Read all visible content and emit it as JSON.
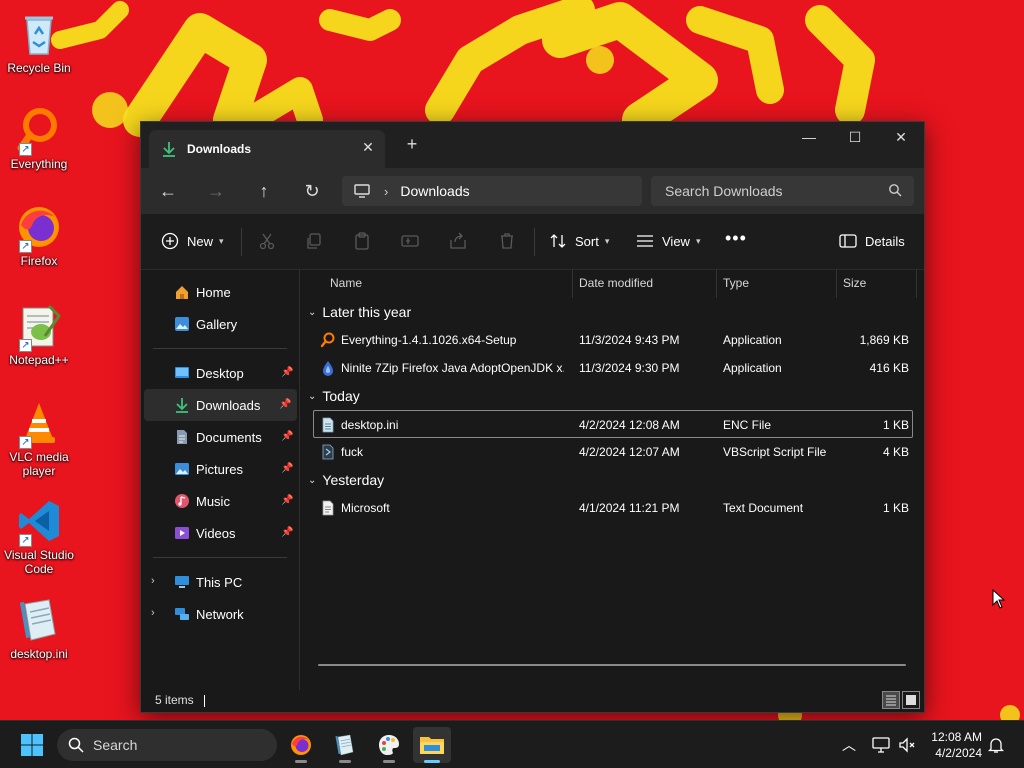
{
  "desktop": {
    "icons": [
      {
        "label": "Recycle Bin",
        "icon": "recycle-bin-icon"
      },
      {
        "label": "Everything",
        "icon": "everything-icon"
      },
      {
        "label": "Firefox",
        "icon": "firefox-icon"
      },
      {
        "label": "Notepad++",
        "icon": "notepad-plus-plus-icon"
      },
      {
        "label": "VLC media player",
        "icon": "vlc-icon"
      },
      {
        "label": "Visual Studio Code",
        "icon": "vscode-icon"
      },
      {
        "label": "desktop.ini",
        "icon": "ini-file-icon"
      }
    ],
    "wallpaper_colors": {
      "background": "#e8141e",
      "accent": "#f6e11d"
    }
  },
  "window": {
    "tab_title": "Downloads",
    "breadcrumb": "Downloads",
    "search_placeholder": "Search Downloads",
    "toolbar": {
      "new_label": "New",
      "sort_label": "Sort",
      "view_label": "View",
      "details_label": "Details"
    },
    "nav": {
      "top": [
        {
          "label": "Home",
          "icon": "home-icon"
        },
        {
          "label": "Gallery",
          "icon": "gallery-icon"
        }
      ],
      "quick_access": [
        {
          "label": "Desktop",
          "icon": "desktop-folder-icon",
          "pinned": true
        },
        {
          "label": "Downloads",
          "icon": "downloads-icon",
          "pinned": true,
          "selected": true
        },
        {
          "label": "Documents",
          "icon": "documents-icon",
          "pinned": true
        },
        {
          "label": "Pictures",
          "icon": "pictures-icon",
          "pinned": true
        },
        {
          "label": "Music",
          "icon": "music-icon",
          "pinned": true
        },
        {
          "label": "Videos",
          "icon": "videos-icon",
          "pinned": true
        }
      ],
      "bottom": [
        {
          "label": "This PC",
          "icon": "this-pc-icon"
        },
        {
          "label": "Network",
          "icon": "network-icon"
        }
      ]
    },
    "columns": [
      "Name",
      "Date modified",
      "Type",
      "Size"
    ],
    "groups": [
      {
        "label": "Later this year",
        "rows": [
          {
            "name": "Everything-1.4.1.1026.x64-Setup",
            "date": "11/3/2024 9:43 PM",
            "type": "Application",
            "size": "1,869 KB",
            "icon": "everything-icon"
          },
          {
            "name": "Ninite 7Zip Firefox Java AdoptOpenJDK x...",
            "date": "11/3/2024 9:30 PM",
            "type": "Application",
            "size": "416 KB",
            "icon": "ninite-icon"
          }
        ]
      },
      {
        "label": "Today",
        "rows": [
          {
            "name": "desktop.ini",
            "date": "4/2/2024 12:08 AM",
            "type": "ENC File",
            "size": "1 KB",
            "icon": "ini-file-icon",
            "selected": true
          },
          {
            "name": "fuck",
            "date": "4/2/2024 12:07 AM",
            "type": "VBScript Script File",
            "size": "4 KB",
            "icon": "vbscript-icon"
          }
        ]
      },
      {
        "label": "Yesterday",
        "rows": [
          {
            "name": "Microsoft",
            "date": "4/1/2024 11:21 PM",
            "type": "Text Document",
            "size": "1 KB",
            "icon": "text-document-icon"
          }
        ]
      }
    ],
    "status": "5 items"
  },
  "taskbar": {
    "search_placeholder": "Search",
    "time": "12:08 AM",
    "date": "4/2/2024",
    "apps": [
      "firefox-icon",
      "notepad-icon",
      "paint-icon",
      "file-explorer-icon"
    ]
  }
}
